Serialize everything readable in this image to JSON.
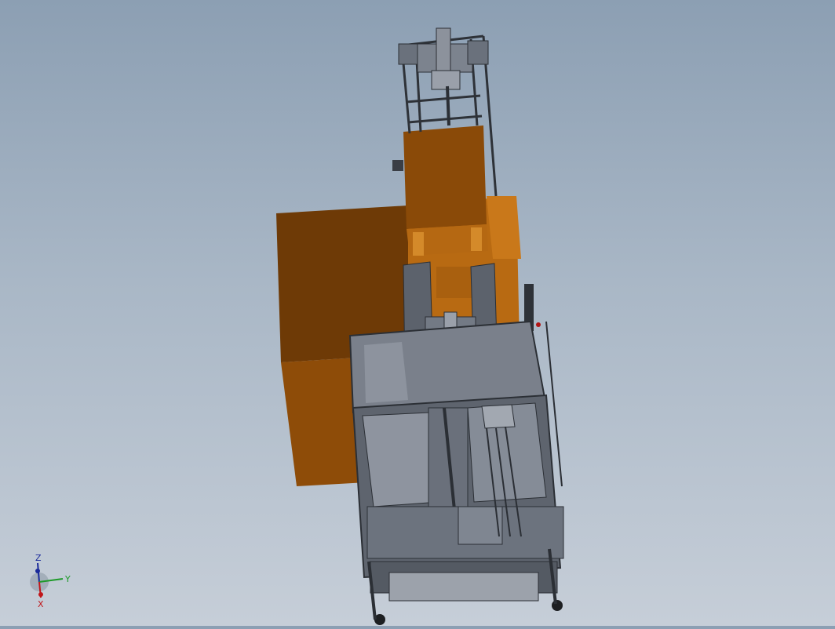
{
  "viewport": {
    "background_top": "#8c9fb3",
    "background_bottom": "#c6ced8",
    "model_colors": {
      "orange": "#b86a12",
      "orange_dark": "#6e3a06",
      "orange_mid": "#8e4c08",
      "frame": "#4a4e55",
      "plate": "#7e8591"
    }
  },
  "triad": {
    "z_label": "Z",
    "y_label": "Y",
    "x_label": "X",
    "z_color": "#1a2a9a",
    "y_color": "#1e9a2a",
    "x_color": "#c0161a"
  }
}
